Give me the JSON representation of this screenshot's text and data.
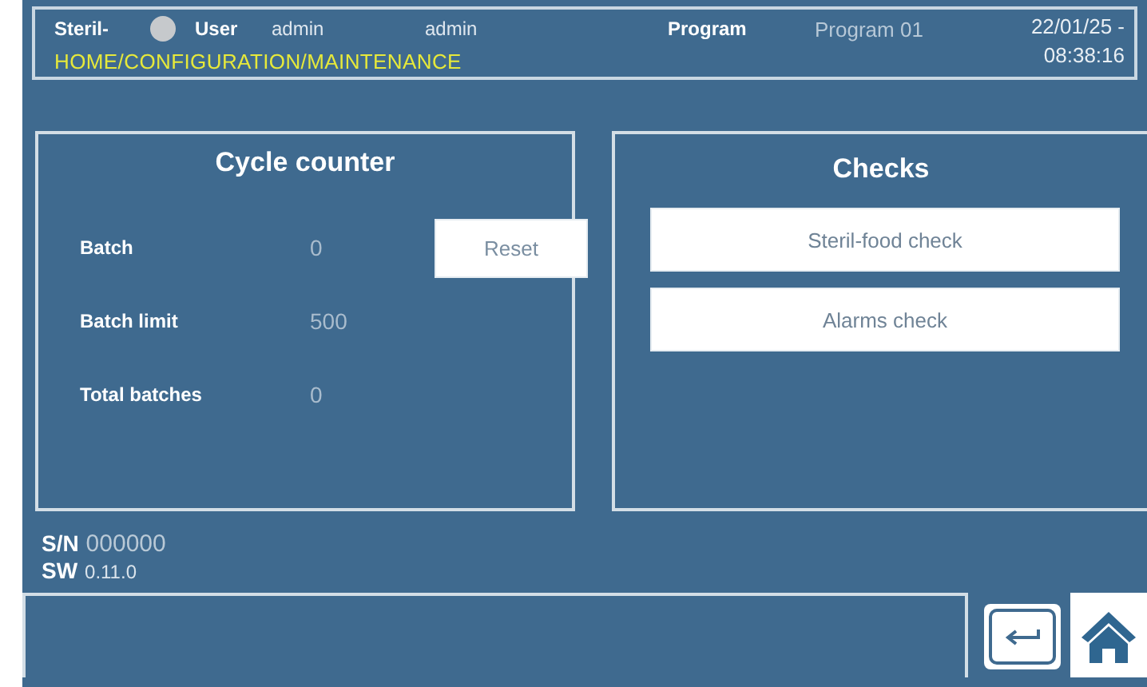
{
  "header": {
    "brand": "Steril-",
    "user_label": "User",
    "user": "admin",
    "user_2": "admin",
    "program_label": "Program",
    "program": "Program 01",
    "date": "22/01/25 -",
    "time": "08:38:16",
    "breadcrumb": "HOME/CONFIGURATION/MAINTENANCE"
  },
  "cycle_counter": {
    "title": "Cycle counter",
    "rows": [
      {
        "label": "Batch",
        "value": "0",
        "button": "Reset"
      },
      {
        "label": "Batch limit",
        "value": "500"
      },
      {
        "label": "Total batches",
        "value": "0"
      }
    ]
  },
  "checks": {
    "title": "Checks",
    "buttons": [
      "Steril-food check",
      "Alarms check"
    ]
  },
  "footer": {
    "sn_label": "S/N",
    "sn": "000000",
    "sw_label": "SW",
    "sw": "0.11.0"
  }
}
